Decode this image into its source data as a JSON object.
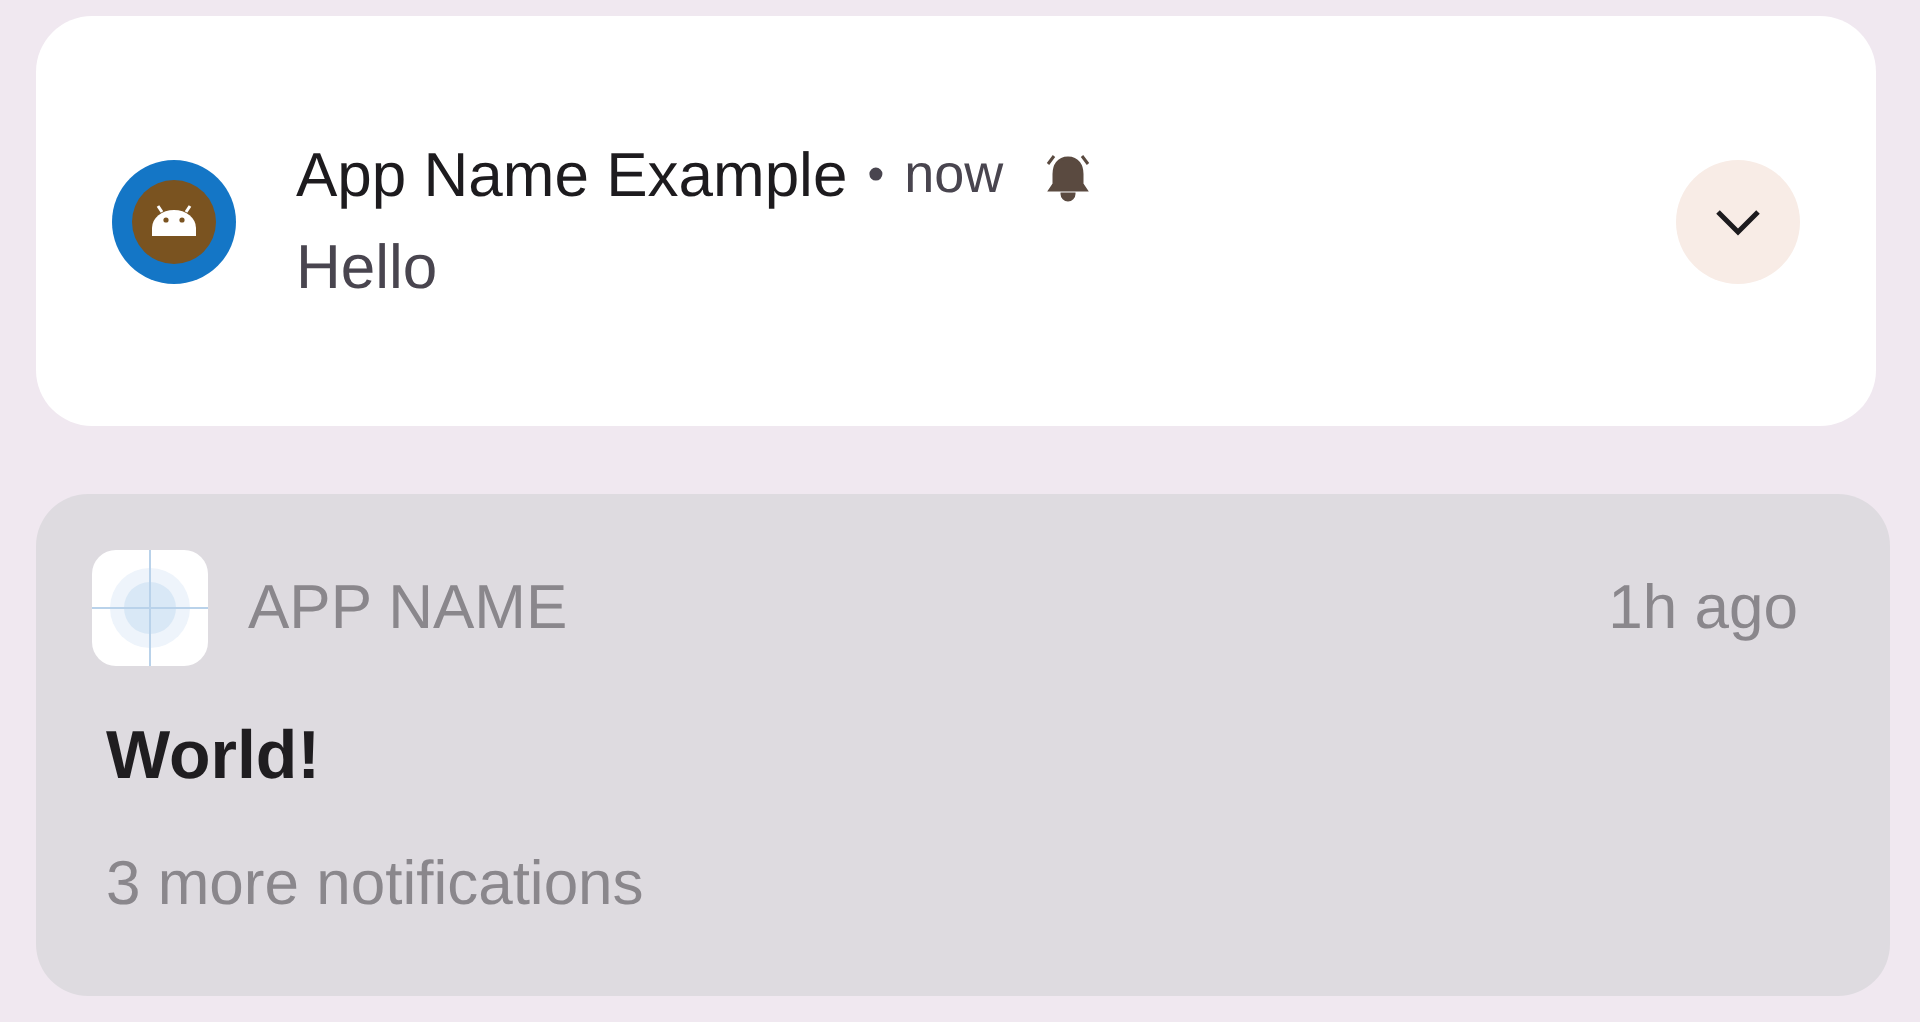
{
  "android_notification": {
    "app_name": "App Name Example",
    "separator": "•",
    "time": "now",
    "title": "Hello",
    "expanded": false
  },
  "ios_notification": {
    "app_name": "APP NAME",
    "time": "1h ago",
    "title": "World!",
    "more": "3 more notifications"
  }
}
